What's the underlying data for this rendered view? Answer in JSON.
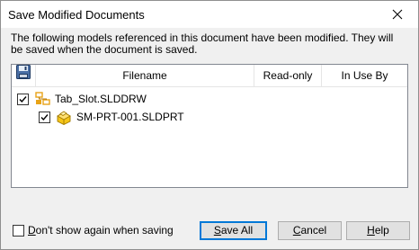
{
  "window": {
    "title": "Save Modified Documents",
    "close_glyph": "close-icon"
  },
  "message": "The following models referenced in this document have been modified. They will be saved when the document is saved.",
  "columns": {
    "icon": "save-disk-icon",
    "filename": "Filename",
    "read_only": "Read-only",
    "in_use_by": "In Use By"
  },
  "files": [
    {
      "name": "Tab_Slot.SLDDRW",
      "checked": true,
      "icon": "drawing-icon",
      "read_only": "",
      "in_use_by": ""
    },
    {
      "name": "SM-PRT-001.SLDPRT",
      "checked": true,
      "icon": "part-icon",
      "read_only": "",
      "in_use_by": ""
    }
  ],
  "footer": {
    "dont_show_checked": false,
    "dont_show_label_hotkey": "D",
    "dont_show_label_rest": "on't show again when saving"
  },
  "buttons": {
    "save_all_hotkey": "S",
    "save_all_rest": "ave All",
    "cancel_hotkey": "C",
    "cancel_rest": "ancel",
    "help_hotkey": "H",
    "help_rest": "elp"
  },
  "colors": {
    "default_button_border": "#0078d7",
    "content_background": "#f0f0f0",
    "part_icon": "#f5c518",
    "drawing_icon": "#e8a317"
  }
}
